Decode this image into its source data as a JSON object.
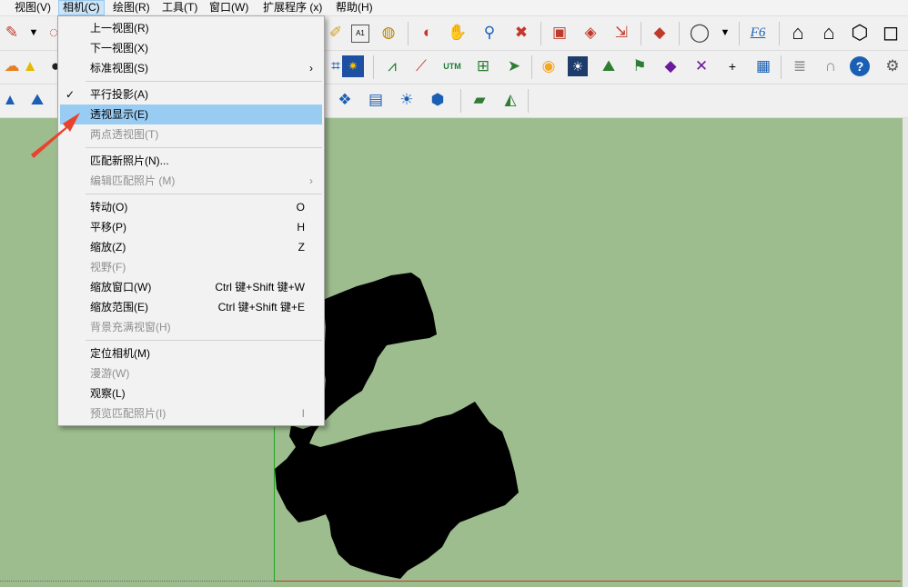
{
  "menubar": [
    {
      "label": "视图(V)"
    },
    {
      "label": "相机(C)"
    },
    {
      "label": "绘图(R)"
    },
    {
      "label": "工具(T)"
    },
    {
      "label": "窗口(W)"
    },
    {
      "label": "扩展程序 (x)"
    },
    {
      "label": "帮助(H)"
    }
  ],
  "camera_menu": {
    "items": [
      {
        "label": "上一视图(R)"
      },
      {
        "label": "下一视图(X)"
      },
      {
        "label": "标准视图(S)",
        "submenu_arrow": "›"
      },
      {
        "label": "平行投影(A)",
        "checkmark": "✓"
      },
      {
        "label": "透视显示(E)"
      },
      {
        "label": "两点透视图(T)"
      },
      {
        "label": "匹配新照片(N)..."
      },
      {
        "label": "编辑匹配照片 (M)",
        "submenu_arrow": "›"
      },
      {
        "label": "转动(O)",
        "shortcut": "O"
      },
      {
        "label": "平移(P)",
        "shortcut": "H"
      },
      {
        "label": "缩放(Z)",
        "shortcut": "Z"
      },
      {
        "label": "视野(F)"
      },
      {
        "label": "缩放窗口(W)",
        "shortcut": "Ctrl 键+Shift 键+W"
      },
      {
        "label": "缩放范围(E)",
        "shortcut": "Ctrl 键+Shift 键+E"
      },
      {
        "label": "背景充满视窗(H)"
      },
      {
        "label": "定位相机(M)"
      },
      {
        "label": "漫游(W)"
      },
      {
        "label": "观察(L)"
      },
      {
        "label": "预览匹配照片(I)",
        "shortcut": "I"
      }
    ]
  },
  "toolbar": {
    "utm_label": "UTM",
    "a1_label": "A1",
    "f6_label": "F6",
    "plus_label": "+"
  },
  "colors": {
    "canvas": "#9ebd8e",
    "highlight": "#99ccf3",
    "annotation_arrow": "#e8432c",
    "model": "#000000"
  }
}
